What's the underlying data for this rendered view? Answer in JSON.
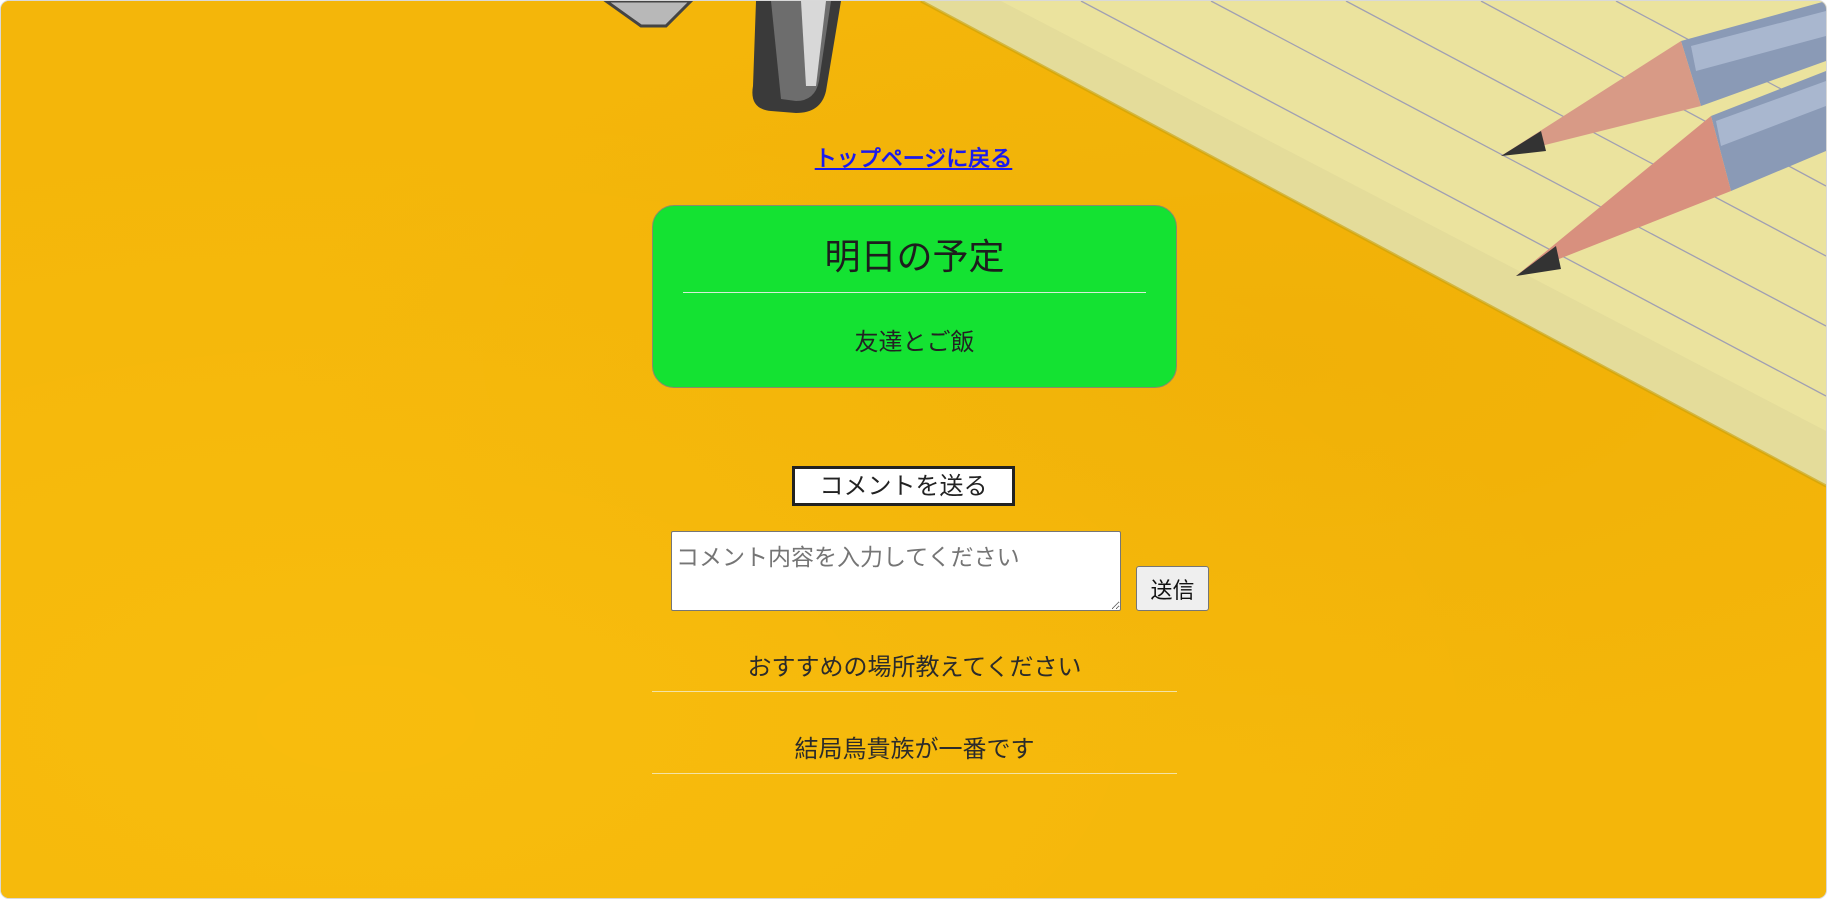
{
  "nav": {
    "back_to_top": "トップページに戻る"
  },
  "schedule": {
    "title": "明日の予定",
    "body": "友達とご飯"
  },
  "comment_form": {
    "heading": "コメントを送る",
    "placeholder": "コメント内容を入力してください",
    "submit_label": "送信"
  },
  "comments": [
    "おすすめの場所教えてください",
    "結局鳥貴族が一番です"
  ],
  "colors": {
    "background": "#f4b60a",
    "card": "#14e232",
    "link": "#1a1aee"
  }
}
